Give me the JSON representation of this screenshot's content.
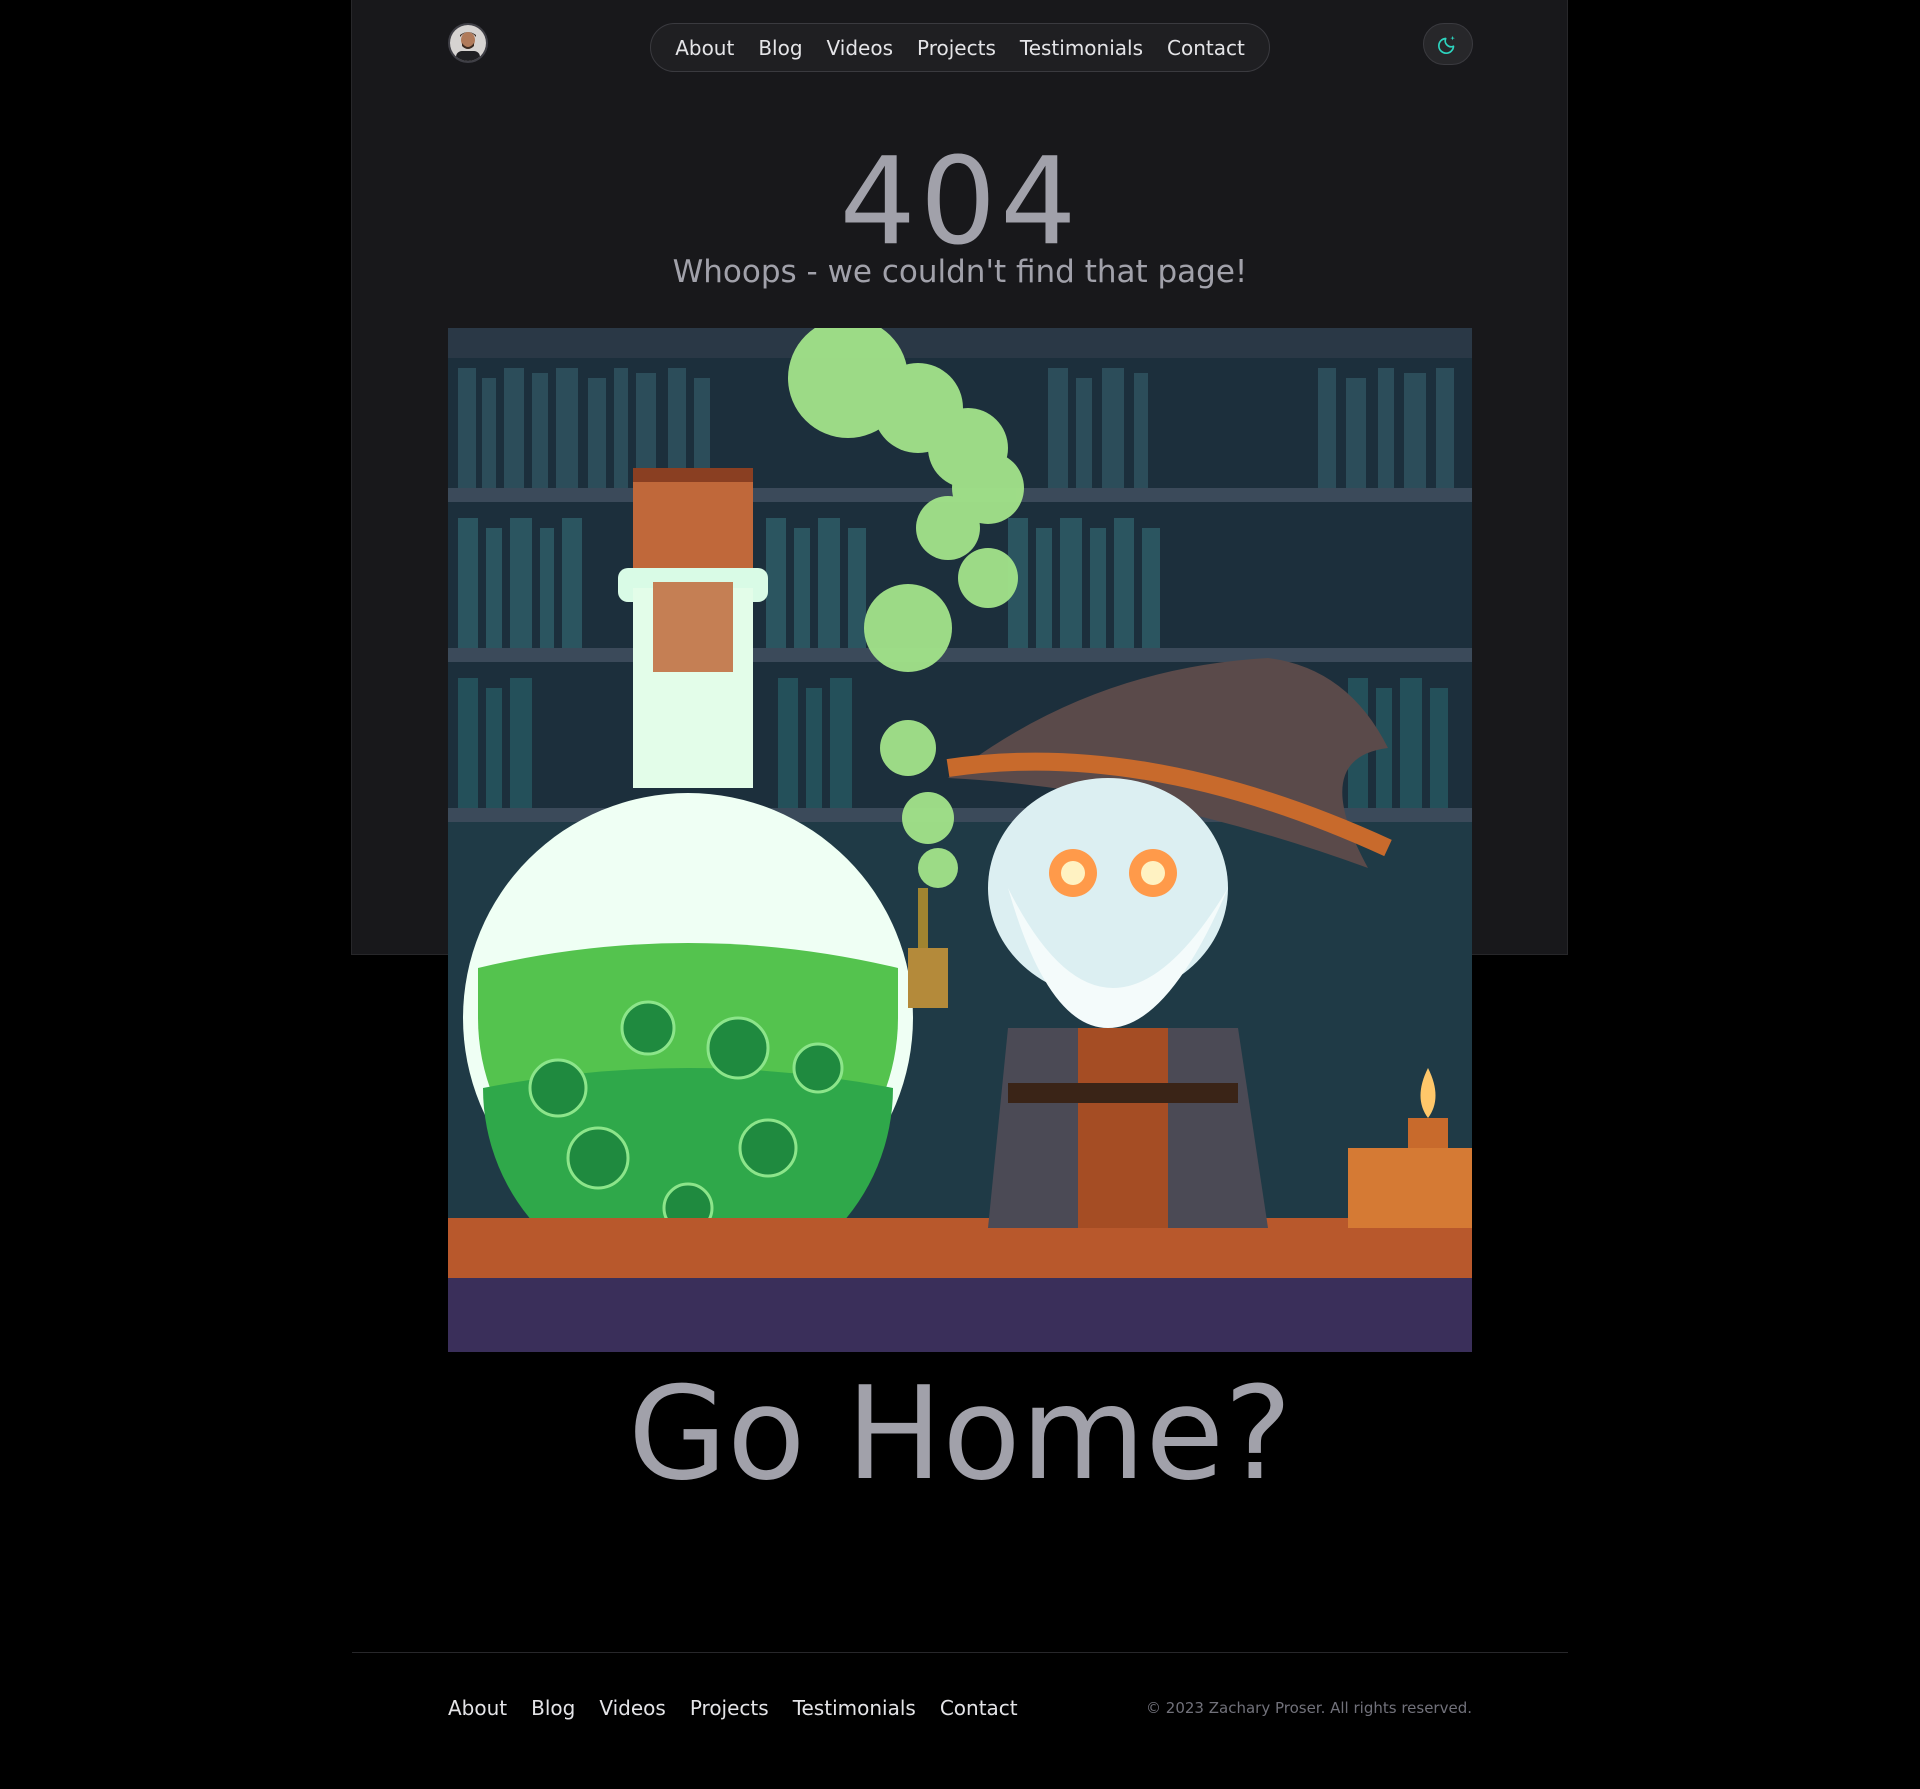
{
  "header": {
    "avatar_alt": "avatar",
    "nav": [
      {
        "label": "About"
      },
      {
        "label": "Blog"
      },
      {
        "label": "Videos"
      },
      {
        "label": "Projects"
      },
      {
        "label": "Testimonials"
      },
      {
        "label": "Contact"
      }
    ],
    "theme_toggle_icon": "moon-sparkle-icon"
  },
  "main": {
    "error_code": "404",
    "message": "Whoops - we couldn't find that page!",
    "illustration": "pixel-art-wizard-with-green-potion-flask",
    "cta_label": "Go Home?"
  },
  "footer": {
    "nav": [
      {
        "label": "About"
      },
      {
        "label": "Blog"
      },
      {
        "label": "Videos"
      },
      {
        "label": "Projects"
      },
      {
        "label": "Testimonials"
      },
      {
        "label": "Contact"
      }
    ],
    "copyright": "© 2023 Zachary Proser. All rights reserved."
  },
  "colors": {
    "page_bg": "#000000",
    "panel_bg": "#18181b",
    "text_muted": "#a1a1aa",
    "nav_text": "#e4e4e7",
    "accent": "#2dd4bf"
  }
}
